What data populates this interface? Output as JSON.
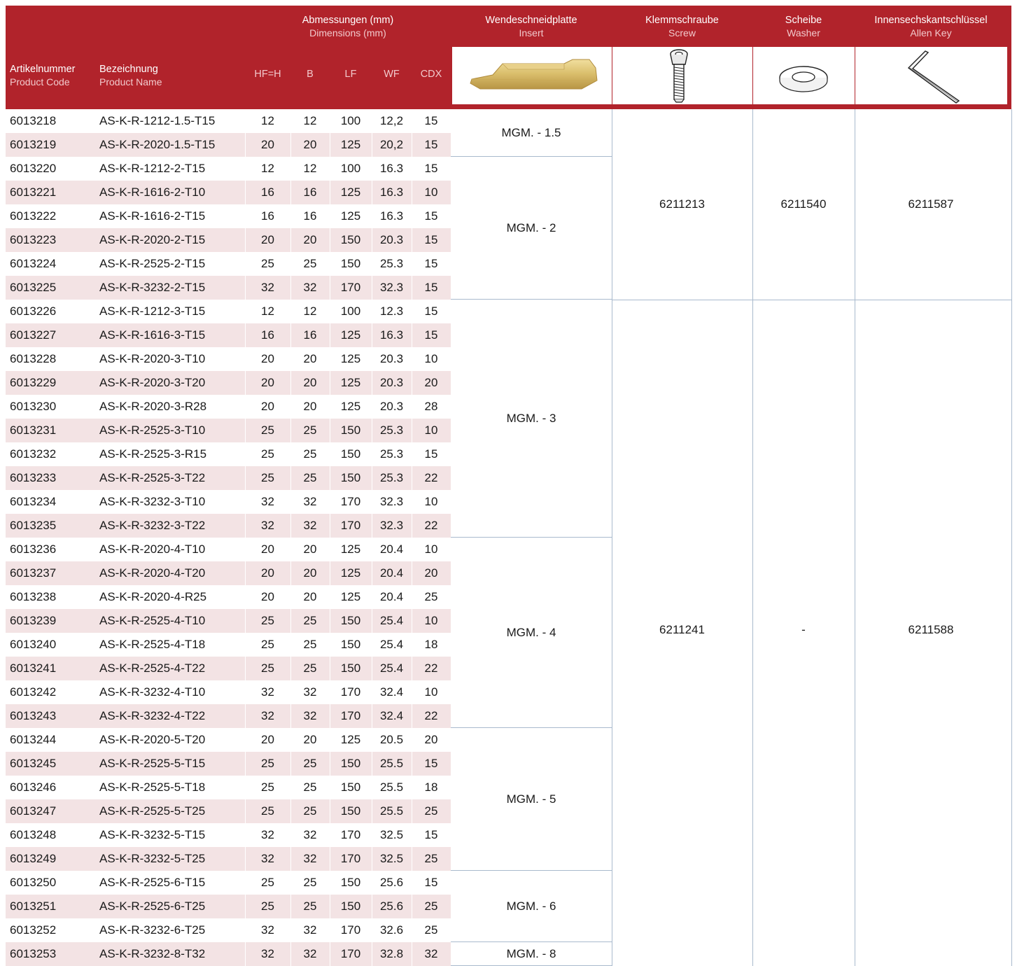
{
  "header": {
    "product_code": {
      "de": "Artikelnummer",
      "en": "Product Code"
    },
    "product_name": {
      "de": "Bezeichnung",
      "en": "Product Name"
    },
    "dimensions": {
      "de": "Abmessungen (mm)",
      "en": "Dimensions (mm)"
    },
    "dim_cols": [
      "HF=H",
      "B",
      "LF",
      "WF",
      "CDX"
    ],
    "insert": {
      "de": "Wendeschneidplatte",
      "en": "Insert"
    },
    "screw": {
      "de": "Klemmschraube",
      "en": "Screw"
    },
    "washer": {
      "de": "Scheibe",
      "en": "Washer"
    },
    "allen_key": {
      "de": "Innensechskantschlüssel",
      "en": "Allen Key"
    },
    "icons": [
      "insert-icon",
      "screw-icon",
      "washer-icon",
      "allen-key-icon"
    ]
  },
  "colors": {
    "header_red": "#b1232b",
    "row_alt": "#f3e3e4",
    "grid_line": "#a9bacd"
  },
  "rows": [
    {
      "code": "6013218",
      "name": "AS-K-R-1212-1.5-T15",
      "hf": "12",
      "b": "12",
      "lf": "100",
      "wf": "12,2",
      "cdx": "15"
    },
    {
      "code": "6013219",
      "name": "AS-K-R-2020-1.5-T15",
      "hf": "20",
      "b": "20",
      "lf": "125",
      "wf": "20,2",
      "cdx": "15"
    },
    {
      "code": "6013220",
      "name": "AS-K-R-1212-2-T15",
      "hf": "12",
      "b": "12",
      "lf": "100",
      "wf": "16.3",
      "cdx": "15"
    },
    {
      "code": "6013221",
      "name": "AS-K-R-1616-2-T10",
      "hf": "16",
      "b": "16",
      "lf": "125",
      "wf": "16.3",
      "cdx": "10"
    },
    {
      "code": "6013222",
      "name": "AS-K-R-1616-2-T15",
      "hf": "16",
      "b": "16",
      "lf": "125",
      "wf": "16.3",
      "cdx": "15"
    },
    {
      "code": "6013223",
      "name": "AS-K-R-2020-2-T15",
      "hf": "20",
      "b": "20",
      "lf": "150",
      "wf": "20.3",
      "cdx": "15"
    },
    {
      "code": "6013224",
      "name": "AS-K-R-2525-2-T15",
      "hf": "25",
      "b": "25",
      "lf": "150",
      "wf": "25.3",
      "cdx": "15"
    },
    {
      "code": "6013225",
      "name": "AS-K-R-3232-2-T15",
      "hf": "32",
      "b": "32",
      "lf": "170",
      "wf": "32.3",
      "cdx": "15"
    },
    {
      "code": "6013226",
      "name": "AS-K-R-1212-3-T15",
      "hf": "12",
      "b": "12",
      "lf": "100",
      "wf": "12.3",
      "cdx": "15"
    },
    {
      "code": "6013227",
      "name": "AS-K-R-1616-3-T15",
      "hf": "16",
      "b": "16",
      "lf": "125",
      "wf": "16.3",
      "cdx": "15"
    },
    {
      "code": "6013228",
      "name": "AS-K-R-2020-3-T10",
      "hf": "20",
      "b": "20",
      "lf": "125",
      "wf": "20.3",
      "cdx": "10"
    },
    {
      "code": "6013229",
      "name": "AS-K-R-2020-3-T20",
      "hf": "20",
      "b": "20",
      "lf": "125",
      "wf": "20.3",
      "cdx": "20"
    },
    {
      "code": "6013230",
      "name": "AS-K-R-2020-3-R28",
      "hf": "20",
      "b": "20",
      "lf": "125",
      "wf": "20.3",
      "cdx": "28"
    },
    {
      "code": "6013231",
      "name": "AS-K-R-2525-3-T10",
      "hf": "25",
      "b": "25",
      "lf": "150",
      "wf": "25.3",
      "cdx": "10"
    },
    {
      "code": "6013232",
      "name": "AS-K-R-2525-3-R15",
      "hf": "25",
      "b": "25",
      "lf": "150",
      "wf": "25.3",
      "cdx": "15"
    },
    {
      "code": "6013233",
      "name": "AS-K-R-2525-3-T22",
      "hf": "25",
      "b": "25",
      "lf": "150",
      "wf": "25.3",
      "cdx": "22"
    },
    {
      "code": "6013234",
      "name": "AS-K-R-3232-3-T10",
      "hf": "32",
      "b": "32",
      "lf": "170",
      "wf": "32.3",
      "cdx": "10"
    },
    {
      "code": "6013235",
      "name": "AS-K-R-3232-3-T22",
      "hf": "32",
      "b": "32",
      "lf": "170",
      "wf": "32.3",
      "cdx": "22"
    },
    {
      "code": "6013236",
      "name": "AS-K-R-2020-4-T10",
      "hf": "20",
      "b": "20",
      "lf": "125",
      "wf": "20.4",
      "cdx": "10"
    },
    {
      "code": "6013237",
      "name": "AS-K-R-2020-4-T20",
      "hf": "20",
      "b": "20",
      "lf": "125",
      "wf": "20.4",
      "cdx": "20"
    },
    {
      "code": "6013238",
      "name": "AS-K-R-2020-4-R25",
      "hf": "20",
      "b": "20",
      "lf": "125",
      "wf": "20.4",
      "cdx": "25"
    },
    {
      "code": "6013239",
      "name": "AS-K-R-2525-4-T10",
      "hf": "25",
      "b": "25",
      "lf": "150",
      "wf": "25.4",
      "cdx": "10"
    },
    {
      "code": "6013240",
      "name": "AS-K-R-2525-4-T18",
      "hf": "25",
      "b": "25",
      "lf": "150",
      "wf": "25.4",
      "cdx": "18"
    },
    {
      "code": "6013241",
      "name": "AS-K-R-2525-4-T22",
      "hf": "25",
      "b": "25",
      "lf": "150",
      "wf": "25.4",
      "cdx": "22"
    },
    {
      "code": "6013242",
      "name": "AS-K-R-3232-4-T10",
      "hf": "32",
      "b": "32",
      "lf": "170",
      "wf": "32.4",
      "cdx": "10"
    },
    {
      "code": "6013243",
      "name": "AS-K-R-3232-4-T22",
      "hf": "32",
      "b": "32",
      "lf": "170",
      "wf": "32.4",
      "cdx": "22"
    },
    {
      "code": "6013244",
      "name": "AS-K-R-2020-5-T20",
      "hf": "20",
      "b": "20",
      "lf": "125",
      "wf": "20.5",
      "cdx": "20"
    },
    {
      "code": "6013245",
      "name": "AS-K-R-2525-5-T15",
      "hf": "25",
      "b": "25",
      "lf": "150",
      "wf": "25.5",
      "cdx": "15"
    },
    {
      "code": "6013246",
      "name": "AS-K-R-2525-5-T18",
      "hf": "25",
      "b": "25",
      "lf": "150",
      "wf": "25.5",
      "cdx": "18"
    },
    {
      "code": "6013247",
      "name": "AS-K-R-2525-5-T25",
      "hf": "25",
      "b": "25",
      "lf": "150",
      "wf": "25.5",
      "cdx": "25"
    },
    {
      "code": "6013248",
      "name": "AS-K-R-3232-5-T15",
      "hf": "32",
      "b": "32",
      "lf": "170",
      "wf": "32.5",
      "cdx": "15"
    },
    {
      "code": "6013249",
      "name": "AS-K-R-3232-5-T25",
      "hf": "32",
      "b": "32",
      "lf": "170",
      "wf": "32.5",
      "cdx": "25"
    },
    {
      "code": "6013250",
      "name": "AS-K-R-2525-6-T15",
      "hf": "25",
      "b": "25",
      "lf": "150",
      "wf": "25.6",
      "cdx": "15"
    },
    {
      "code": "6013251",
      "name": "AS-K-R-2525-6-T25",
      "hf": "25",
      "b": "25",
      "lf": "150",
      "wf": "25.6",
      "cdx": "25"
    },
    {
      "code": "6013252",
      "name": "AS-K-R-3232-6-T25",
      "hf": "32",
      "b": "32",
      "lf": "170",
      "wf": "32.6",
      "cdx": "25"
    },
    {
      "code": "6013253",
      "name": "AS-K-R-3232-8-T32",
      "hf": "32",
      "b": "32",
      "lf": "170",
      "wf": "32.8",
      "cdx": "32"
    }
  ],
  "insert_groups": [
    {
      "label": "MGM. - 1.5",
      "rows": 2
    },
    {
      "label": "MGM. - 2",
      "rows": 6
    },
    {
      "label": "MGM. - 3",
      "rows": 10
    },
    {
      "label": "MGM. - 4",
      "rows": 8
    },
    {
      "label": "MGM. - 5",
      "rows": 6
    },
    {
      "label": "MGM. - 6",
      "rows": 3
    },
    {
      "label": "MGM. - 8",
      "rows": 1
    }
  ],
  "accessory_groups": [
    {
      "rows": 8,
      "screw": "6211213",
      "washer": "6211540",
      "allen_key": "6211587"
    },
    {
      "rows": 28,
      "screw": "6211241",
      "washer": "-",
      "allen_key": "6211588"
    }
  ]
}
